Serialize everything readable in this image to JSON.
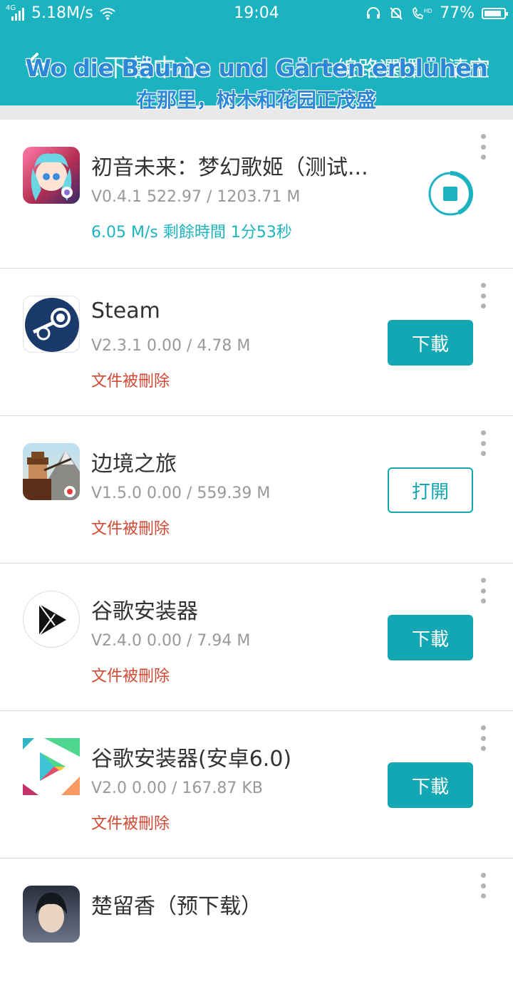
{
  "status_bar": {
    "network_gen": "4G",
    "speed": "5.18M/s",
    "time": "19:04",
    "battery": "77%",
    "battery_level": 0.77
  },
  "header": {
    "title": "下載中心",
    "route_label": "線路選擇",
    "clear_label": "清空"
  },
  "overlay": {
    "line1": "Wo die Bäume und Gärten erblühen",
    "line2": "在那里，树木和花园正茂盛"
  },
  "items": [
    {
      "name": "初音未来：梦幻歌姬（测试...",
      "meta": "V0.4.1  522.97 / 1203.71 M",
      "status": "6.05 M/s  剩餘時間 1分53秒",
      "progress": 0.434,
      "icon": "hatsune-miku-app-icon"
    },
    {
      "name": "Steam",
      "meta": "V2.3.1  0.00 / 4.78 M",
      "status": "文件被刪除",
      "action": "下載",
      "icon": "steam-app-icon"
    },
    {
      "name": "边境之旅",
      "meta": "V1.5.0  0.00 / 559.39 M",
      "status": "文件被刪除",
      "action": "打開",
      "icon": "frontier-journey-app-icon"
    },
    {
      "name": "谷歌安装器",
      "meta": "V2.4.0  0.00 / 7.94 M",
      "status": "文件被刪除",
      "action": "下載",
      "icon": "google-installer-app-icon"
    },
    {
      "name": "谷歌安装器(安卓6.0)",
      "meta": "V2.0  0.00 / 167.87 KB",
      "status": "文件被刪除",
      "action": "下載",
      "icon": "google-play-app-icon"
    },
    {
      "name": "楚留香（预下载）",
      "icon": "chu-liu-xiang-app-icon"
    }
  ],
  "colors": {
    "accent": "#1cb3c0",
    "button": "#13a6b3",
    "error": "#d24a35",
    "meta": "#999999",
    "overlay_text": "#2c87d6"
  }
}
